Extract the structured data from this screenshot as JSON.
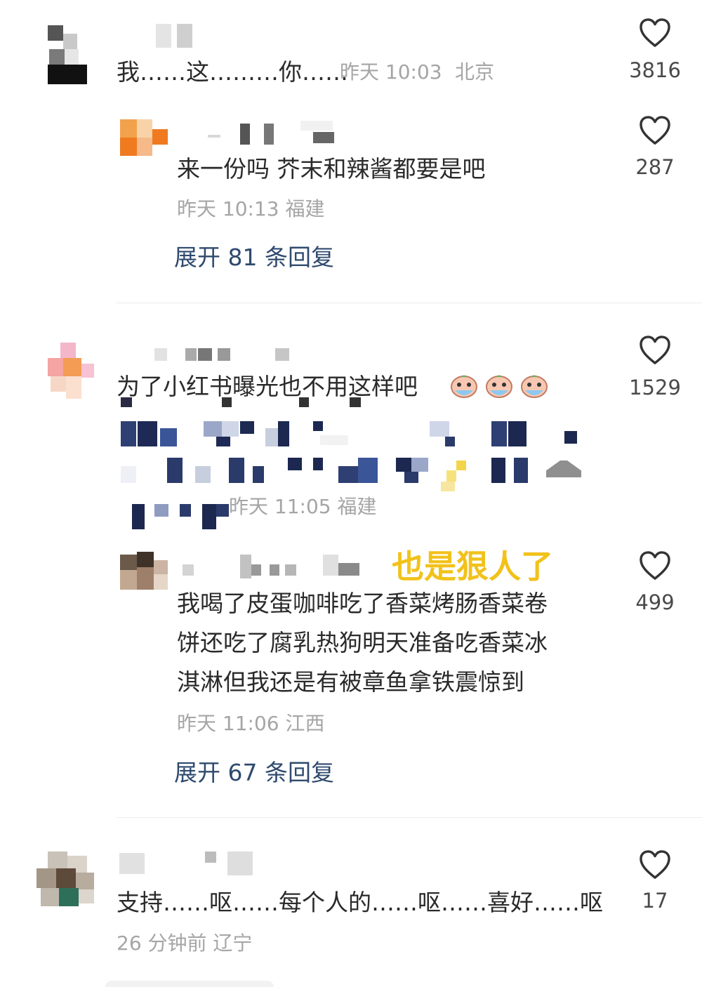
{
  "comments": [
    {
      "text": "我……这………你……",
      "time": "昨天 10:03",
      "location": "北京",
      "likes": "3816",
      "reply": {
        "text": "来一份吗 芥末和辣酱都要是吧",
        "meta": "昨天 10:13 福建",
        "likes": "287",
        "expand": "展开 81 条回复"
      }
    },
    {
      "text": "为了小红书曝光也不用这样吧",
      "meta": "昨天 11:05 福建",
      "likes": "1529",
      "annotation": "也是狠人了",
      "reply": {
        "lines": [
          "我喝了皮蛋咖啡吃了香菜烤肠香菜卷",
          "饼还吃了腐乳热狗明天准备吃香菜冰",
          "淇淋但我还是有被章鱼拿铁震惊到"
        ],
        "meta": "昨天 11:06 江西",
        "likes": "499",
        "expand": "展开 67 条回复"
      }
    },
    {
      "text": "支持……呕……每个人的……呕……喜好……呕",
      "meta": "26 分钟前 辽宁",
      "likes": "17"
    }
  ],
  "icons": {
    "like": "heart-outline-icon",
    "emoji": "crying-face-emoji-icon"
  },
  "colors": {
    "text": "#2a2a2a",
    "meta": "#a5a5a5",
    "expand": "#2f4a6e",
    "annotation": "#f2c21b"
  }
}
